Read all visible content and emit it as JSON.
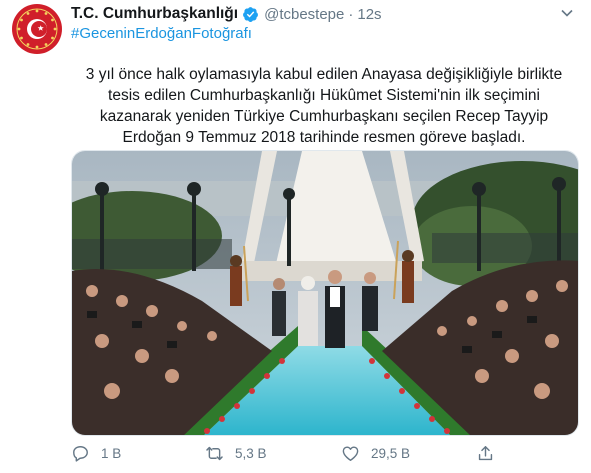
{
  "tweet": {
    "display_name": "T.C. Cumhurbaşkanlığı",
    "handle": "@tcbestepe",
    "separator": "·",
    "time": "12s",
    "hashtag": "#GeceninErdoğanFotoğrafı",
    "text": "3 yıl önce halk oylamasıyla kabul edilen Anayasa değişikliğiyle birlikte tesis edilen Cumhurbaşkanlığı Hükûmet Sistemi'nin ilk seçimini kazanarak yeniden Türkiye Cumhurbaşkanı seçilen Recep Tayyip Erdoğan 9 Temmuz 2018 tarihinde resmen göreve başladı."
  },
  "actions": {
    "reply_count": "1 B",
    "retweet_count": "5,3 B",
    "like_count": "29,5 B"
  },
  "icons": {
    "avatar": "presidential-seal-icon",
    "verified": "verified-badge-icon",
    "menu": "chevron-down-icon",
    "reply": "reply-icon",
    "retweet": "retweet-icon",
    "like": "heart-icon",
    "share": "share-icon"
  },
  "colors": {
    "link": "#1b95e0",
    "secondary_text": "#657786",
    "verified": "#1da1f2",
    "seal": "#d01f2a",
    "carpet": "#3ebfd4"
  }
}
